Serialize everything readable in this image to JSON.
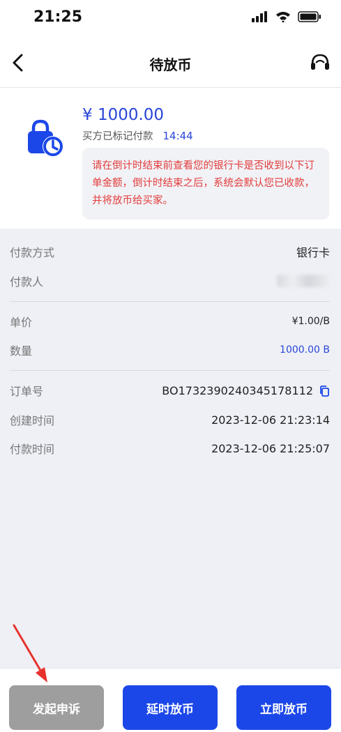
{
  "status_bar": {
    "time": "21:25"
  },
  "header": {
    "title": "待放币"
  },
  "order_summary": {
    "amount": "¥ 1000.00",
    "status_text": "买方已标记付款",
    "countdown": "14:44",
    "notice": "请在倒计时结束前查看您的银行卡是否收到以下订单金额，倒计时结束之后，系统会默认您已收款，并将放币给买家。"
  },
  "payment": {
    "method_label": "付款方式",
    "method_value": "银行卡",
    "payer_label": "付款人"
  },
  "trade": {
    "price_label": "单价",
    "price_value": "¥1.00/B",
    "qty_label": "数量",
    "qty_value": "1000.00 B"
  },
  "order": {
    "id_label": "订单号",
    "id_value": "BO1732390240345178112",
    "created_label": "创建时间",
    "created_value": "2023-12-06 21:23:14",
    "paid_label": "付款时间",
    "paid_value": "2023-12-06 21:25:07"
  },
  "actions": {
    "appeal": "发起申诉",
    "delay_release": "延时放币",
    "release_now": "立即放币"
  },
  "colors": {
    "accent": "#1c47e8",
    "warning": "#e23c3c",
    "disabled": "#9e9e9e"
  }
}
